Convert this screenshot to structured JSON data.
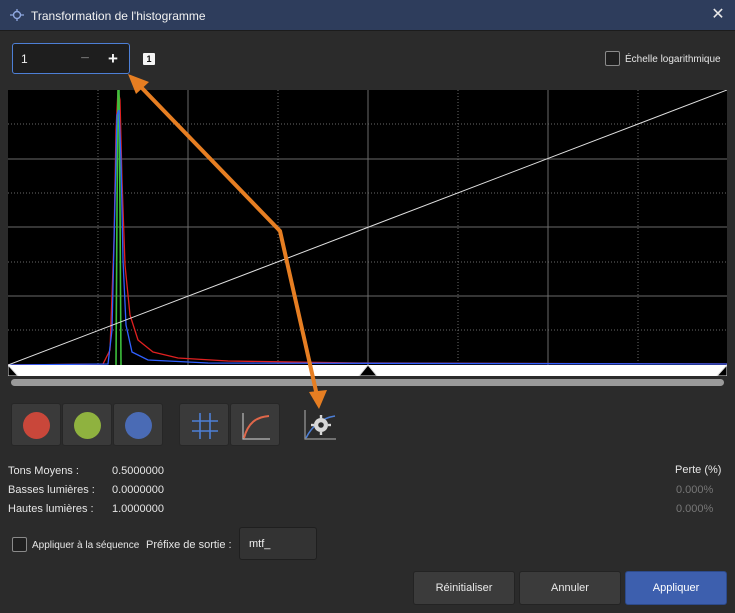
{
  "window": {
    "title": "Transformation de l'histogramme"
  },
  "zoom": {
    "value": "1",
    "minus": "−",
    "plus": "+",
    "badge": "1"
  },
  "log_scale": {
    "label": "Échelle logarithmique",
    "checked": false
  },
  "channels": {
    "red": "#c9473a",
    "green": "#8fb23f",
    "blue": "#4a6bb5"
  },
  "stats": {
    "midtones_label": "Tons Moyens :",
    "midtones_value": "0.5000000",
    "shadows_label": "Basses lumières :",
    "shadows_value": "0.0000000",
    "highlights_label": "Hautes lumières :",
    "highlights_value": "1.0000000",
    "loss_header": "Perte (%)",
    "shadows_loss": "0.000%",
    "highlights_loss": "0.000%"
  },
  "sequence": {
    "label": "Appliquer à la séquence",
    "checked": false
  },
  "prefix": {
    "label": "Préfixe de sortie :",
    "value": "mtf_"
  },
  "buttons": {
    "reset": "Réinitialiser",
    "cancel": "Annuler",
    "apply": "Appliquer"
  },
  "colors": {
    "arrow": "#e67e22",
    "accent": "#3d5fae"
  }
}
